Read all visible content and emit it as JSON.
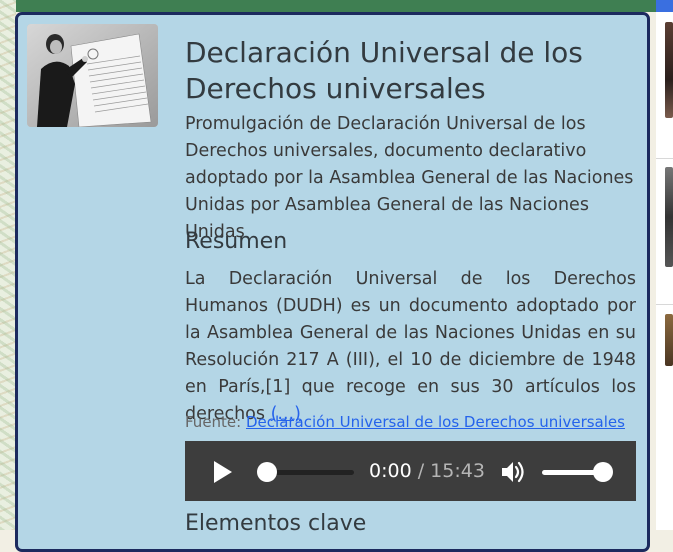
{
  "article": {
    "title": "Declaración Universal de los Derechos universales",
    "subtitle": "Promulgación de Declaración Universal de los Derechos universales, documento declarativo adoptado por la Asamblea General de las Naciones Unidas por Asamblea General de las Naciones Unidas",
    "photo_icon": "photo-of-woman-holding-declaration-poster"
  },
  "summary": {
    "heading": "Resumen",
    "text": "La Declaración Universal de los Derechos Humanos (DUDH) es un documento adoptado por la Asamblea General de las Naciones Unidas en su Resolución 217 A (III), el 10 de diciembre de 1948 en París,[1] que recoge en sus 30 artículos los derechos",
    "more_label": "(...)"
  },
  "source": {
    "label": "Fuente:",
    "link_text": "Declaración Universal de los Derechos universales"
  },
  "audio": {
    "current_time": "0:00",
    "separator": "/",
    "total_time": "15:43",
    "progress": 0,
    "volume": 1
  },
  "sections": {
    "key_elements_heading": "Elementos clave"
  },
  "colors": {
    "panel_bg": "#b4d6e6",
    "panel_border": "#1c2a5e",
    "link": "#2563eb",
    "audio_bg": "#3d3d3d",
    "top_bar": "#3f7f52"
  }
}
